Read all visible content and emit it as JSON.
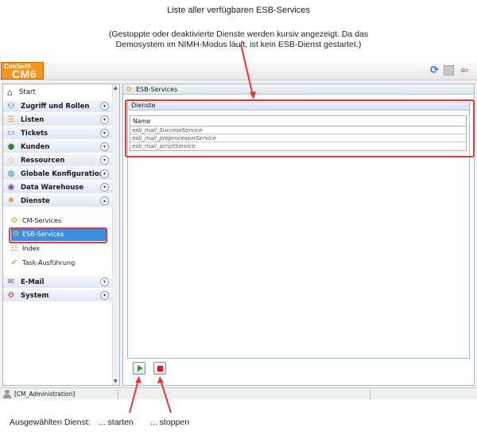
{
  "captions": {
    "top_title": "Liste aller verfügbaren ESB-Services",
    "top_note_line1": "(Gestoppte oder deaktivierte Dienste werden kursiv angezeigt. Da das",
    "top_note_line2": "Demosystem im NIMH-Modus läuft, ist kein ESB-Dienst gestartet.)",
    "bottom_label": "Ausgewählten Dienst:",
    "bottom_start": "... starten",
    "bottom_stop": "... stoppen"
  },
  "logo": {
    "top": "ConSol",
    "mark": "®",
    "bottom_cm": "CM",
    "bottom_ver": "6"
  },
  "sidebar": {
    "start": "Start",
    "categories": [
      {
        "label": "Zugriff und Rollen",
        "icon": "users-icon",
        "color": "#2255aa"
      },
      {
        "label": "Listen",
        "icon": "list-icon",
        "color": "#e6a020"
      },
      {
        "label": "Tickets",
        "icon": "ticket-icon",
        "color": "#3a78c8"
      },
      {
        "label": "Kunden",
        "icon": "customer-icon",
        "color": "#2a8a3a"
      },
      {
        "label": "Ressourcen",
        "icon": "resources-icon",
        "color": "#e6a020"
      },
      {
        "label": "Globale Konfiguration",
        "icon": "globe-icon",
        "color": "#1a9a8a"
      },
      {
        "label": "Data Warehouse",
        "icon": "warehouse-icon",
        "color": "#8a3aa8"
      },
      {
        "label": "Dienste",
        "icon": "services-icon",
        "color": "#e6a020"
      }
    ],
    "dienste_items": [
      {
        "label": "CM-Services",
        "icon": "gears-icon"
      },
      {
        "label": "ESB-Services",
        "icon": "gears-icon"
      },
      {
        "label": "Index",
        "icon": "index-icon"
      },
      {
        "label": "Task-Ausführung",
        "icon": "check-icon"
      }
    ],
    "bottom_categories": [
      {
        "label": "E-Mail",
        "icon": "mail-icon"
      },
      {
        "label": "System",
        "icon": "system-icon"
      }
    ]
  },
  "main": {
    "tab_title": "ESB-Services",
    "panel_title": "Dienste",
    "column_header": "Name",
    "rows": [
      "esb_mail_SuccessService",
      "esb_mail_preprocessorService",
      "esb_mail_scriptService"
    ]
  },
  "status": {
    "user": "[CM_Administration]"
  }
}
